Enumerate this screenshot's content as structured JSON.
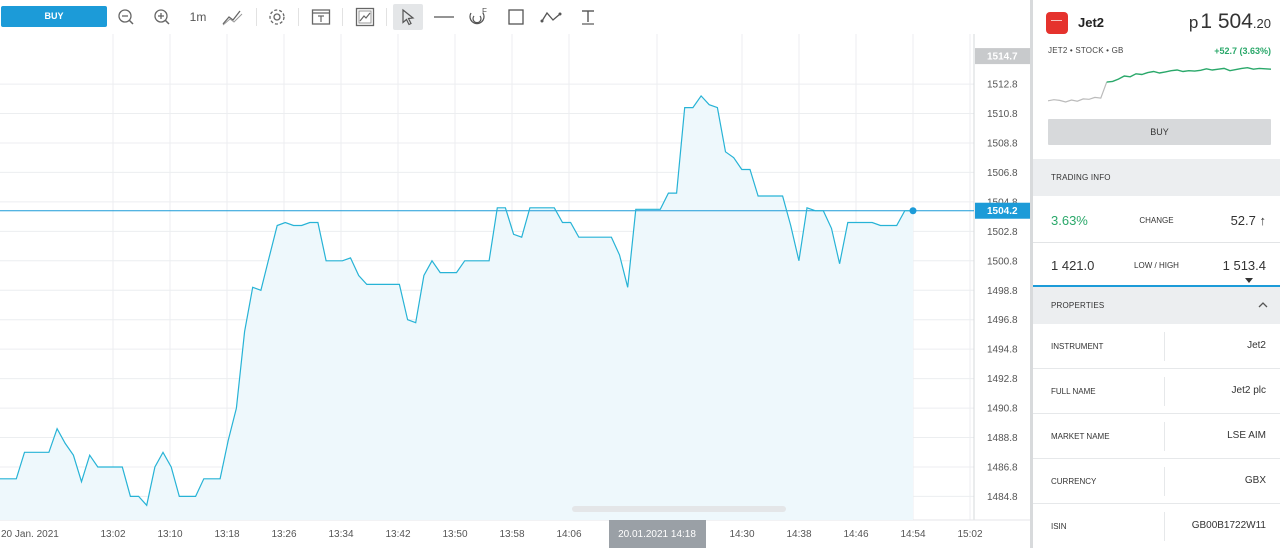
{
  "toolbar": {
    "buy_label": "BUY",
    "interval_label": "1m",
    "icons": [
      "zoom-out-icon",
      "zoom-in-icon",
      "chart-type-icon",
      "settings-icon",
      "template-icon",
      "screenshot-icon",
      "cursor-icon",
      "horizontal-line-icon",
      "fibonacci-icon",
      "rectangle-icon",
      "trend-line-icon",
      "text-tool-icon"
    ]
  },
  "chart_data": {
    "type": "area",
    "x": [
      "13:02",
      "13:10",
      "13:18",
      "13:26",
      "13:34",
      "13:42",
      "13:50",
      "13:58",
      "14:06",
      "14:14",
      "14:22",
      "14:30",
      "14:38",
      "14:46",
      "14:54"
    ],
    "series": [
      {
        "values": [
          1486.0,
          1486.0,
          1486.0,
          1487.8,
          1487.8,
          1487.8,
          1487.8,
          1489.4,
          1488.4,
          1487.6,
          1485.8,
          1487.6,
          1486.8,
          1486.8,
          1486.8,
          1486.8,
          1484.8,
          1484.8,
          1484.2,
          1486.8,
          1487.8,
          1486.8,
          1484.8,
          1484.8,
          1484.8,
          1486.0,
          1486.0,
          1486.0,
          1488.6,
          1490.8,
          1496.0,
          1499.0,
          1498.8,
          1501.0,
          1503.2,
          1503.4,
          1503.2,
          1503.2,
          1503.4,
          1503.4,
          1500.8,
          1500.8,
          1500.8,
          1501.0,
          1499.8,
          1499.2,
          1499.2,
          1499.2,
          1499.2,
          1499.2,
          1496.8,
          1496.6,
          1499.8,
          1500.8,
          1500.0,
          1500.0,
          1500.0,
          1500.8,
          1500.8,
          1500.8,
          1500.8,
          1504.4,
          1504.4,
          1502.6,
          1502.4,
          1504.4,
          1504.4,
          1504.4,
          1504.4,
          1503.4,
          1503.4,
          1502.4,
          1502.4,
          1502.4,
          1502.4,
          1502.4,
          1501.2,
          1499.0,
          1504.3,
          1504.3,
          1504.3,
          1504.3,
          1505.4,
          1505.4,
          1511.2,
          1511.2,
          1512.0,
          1511.4,
          1511.2,
          1508.2,
          1507.8,
          1507.0,
          1507.0,
          1505.2,
          1505.2,
          1505.2,
          1505.2,
          1503.2,
          1500.8,
          1504.4,
          1504.2,
          1504.2,
          1503.0,
          1500.6,
          1503.4,
          1503.4,
          1503.4,
          1503.4,
          1503.2,
          1503.2,
          1503.2,
          1504.2,
          1504.2
        ]
      }
    ],
    "x_axis_labels": [
      "20 Jan. 2021",
      "13:02",
      "13:10",
      "13:18",
      "13:26",
      "13:34",
      "13:42",
      "13:50",
      "13:58",
      "14:06",
      "20.01.2021 14:18",
      "14:30",
      "14:38",
      "14:46",
      "14:54",
      "15:02"
    ],
    "y_tick_labels": [
      "1512.8",
      "1510.8",
      "1508.8",
      "1506.8",
      "1504.8",
      "1502.8",
      "1500.8",
      "1498.8",
      "1496.8",
      "1494.8",
      "1492.8",
      "1490.8",
      "1488.8",
      "1486.8",
      "1484.8"
    ],
    "ylim": [
      1483.2,
      1516.2
    ],
    "current_price_label": "1504.2",
    "max_label": "1514.7",
    "grid": true,
    "line_color": "#27b3d6",
    "fill_color": "#eef8fc",
    "last_line_color": "#1c9bd8"
  },
  "panel": {
    "name": "Jet2",
    "price_currency": "p",
    "price_int": "1 504",
    "price_dec": ".20",
    "meta": "JET2 • STOCK • GB",
    "change": "+52.7  (3.63%)",
    "buy_label": "BUY",
    "trading_info_header": "TRADING INFO",
    "change_pct": "3.63%",
    "change_label": "CHANGE",
    "change_value": "52.7 ↑",
    "low_value": "1 421.0",
    "lowhigh_label": "LOW / HIGH",
    "high_value": "1 513.4",
    "properties_header": "PROPERTIES",
    "properties": [
      {
        "key": "INSTRUMENT",
        "value": "Jet2"
      },
      {
        "key": "FULL NAME",
        "value": "Jet2 plc"
      },
      {
        "key": "MARKET NAME",
        "value": "LSE AIM"
      },
      {
        "key": "CURRENCY",
        "value": "GBX"
      },
      {
        "key": "ISIN",
        "value": "GB00B1722W11"
      }
    ],
    "spark_values": [
      1421,
      1424,
      1422,
      1418,
      1423,
      1420,
      1426,
      1425,
      1430,
      1428,
      1470,
      1472,
      1478,
      1486,
      1484,
      1492,
      1490,
      1495,
      1498,
      1494,
      1497,
      1500,
      1502,
      1498,
      1500,
      1499,
      1501,
      1505,
      1502,
      1504,
      1506,
      1500,
      1503,
      1506,
      1508,
      1504,
      1506,
      1505,
      1504
    ],
    "accent_green": "#2aa86a"
  }
}
